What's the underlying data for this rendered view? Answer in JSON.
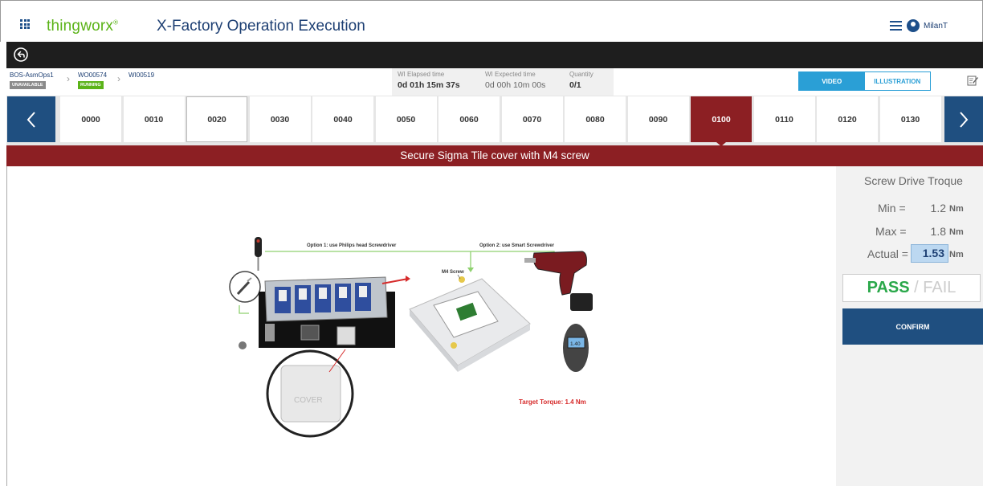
{
  "header": {
    "brand": "thingworx",
    "app_title": "X-Factory Operation Execution",
    "user_name": "MilanT"
  },
  "breadcrumb": [
    {
      "label": "BOS-AsmOps1",
      "status": "UNAVAILABLE",
      "status_color": "#8a8a8a"
    },
    {
      "label": "WO00574",
      "status": "RUNNING",
      "status_color": "#5bb318"
    },
    {
      "label": "WI00519",
      "status": "",
      "status_color": ""
    }
  ],
  "metrics": [
    {
      "label": "WI Elapsed time",
      "value": "0d 01h 15m 37s"
    },
    {
      "label": "WI Expected time",
      "value": "0d 00h 10m 00s"
    },
    {
      "label": "Quantity",
      "value": "0/1"
    }
  ],
  "media": {
    "video_label": "VIDEO",
    "illustration_label": "ILLUSTRATION"
  },
  "operations": [
    "0000",
    "0010",
    "0020",
    "0030",
    "0040",
    "0050",
    "0060",
    "0070",
    "0080",
    "0090",
    "0100",
    "0110",
    "0120",
    "0130"
  ],
  "active_operation": "0100",
  "step_title": "Secure Sigma Tile cover with M4 screw",
  "illustration": {
    "option1": "Option 1:  use Philips head Screwdriver",
    "option2": "Option 2:  use Smart Screwdriver",
    "screw_label": "M4 Screw",
    "target_torque": "Target Torque:  1.4 Nm",
    "display_value": "1.40",
    "cover_text": "COVER"
  },
  "torque_panel": {
    "title": "Screw Drive Troque",
    "min_label": "Min =",
    "min_value": "1.2",
    "max_label": "Max =",
    "max_value": "1.8",
    "actual_label": "Actual =",
    "actual_value": "1.53",
    "unit": "Nm",
    "pass_label": "PASS",
    "separator": "/",
    "fail_label": "FAIL",
    "confirm_label": "CONFIRM"
  },
  "colors": {
    "accent_blue": "#1f4f80",
    "active_red": "#8c1f23",
    "brand_green": "#5bb318",
    "pass_green": "#2aa84a",
    "media_blue": "#2a9fd6"
  }
}
